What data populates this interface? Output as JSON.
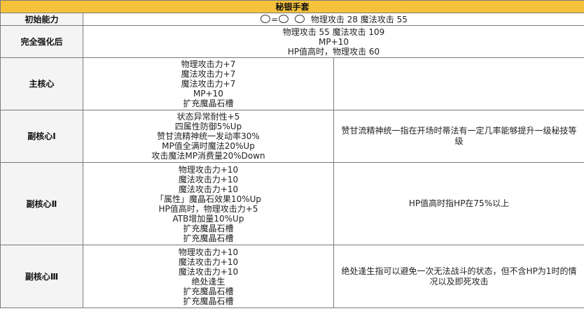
{
  "title": "秘银手套",
  "rows": {
    "initial": {
      "label": "初始能力",
      "slot_eq": "=",
      "stats": "物理攻击 28 魔法攻击 55"
    },
    "enhanced": {
      "label": "完全强化后",
      "lines": [
        "物理攻击 55 魔法攻击 109",
        "MP+10",
        "HP值高时，物理攻击 60"
      ]
    },
    "main_core": {
      "label": "主核心",
      "lines": [
        "物理攻击力+7",
        "魔法攻击力+7",
        "魔法攻击力+7",
        "MP+10",
        "扩充魔晶石槽"
      ],
      "note": ""
    },
    "sub_core_1": {
      "label": "副核心Ⅰ",
      "lines": [
        "状态异常耐性+5",
        "四属性防御5%Up",
        "赞甘流精神统一发动率30%",
        "MP值全满时魔法20%Up",
        "攻击魔法MP消费量20%Down"
      ],
      "note": "赞甘流精神统一指在开场时蒂法有一定几率能够提升一级秘技等级"
    },
    "sub_core_2": {
      "label": "副核心Ⅱ",
      "lines": [
        "物理攻击力+10",
        "魔法攻击力+10",
        "魔法攻击力+10",
        "「属性」魔晶石效果10%Up",
        "HP值高时，物理攻击力+5",
        "ATB增加量10%Up",
        "扩充魔晶石槽",
        "扩充魔晶石槽"
      ],
      "note": "HP值高时指HP在75%以上"
    },
    "sub_core_3": {
      "label": "副核心Ⅲ",
      "lines": [
        "物理攻击力+10",
        "魔法攻击力+10",
        "魔法攻击力+10",
        "绝处逢生",
        "扩充魔晶石槽",
        "扩充魔晶石槽"
      ],
      "note": "绝处逢生指可以避免一次无法战斗的状态，但不含HP为1时的情况以及即死攻击"
    }
  }
}
